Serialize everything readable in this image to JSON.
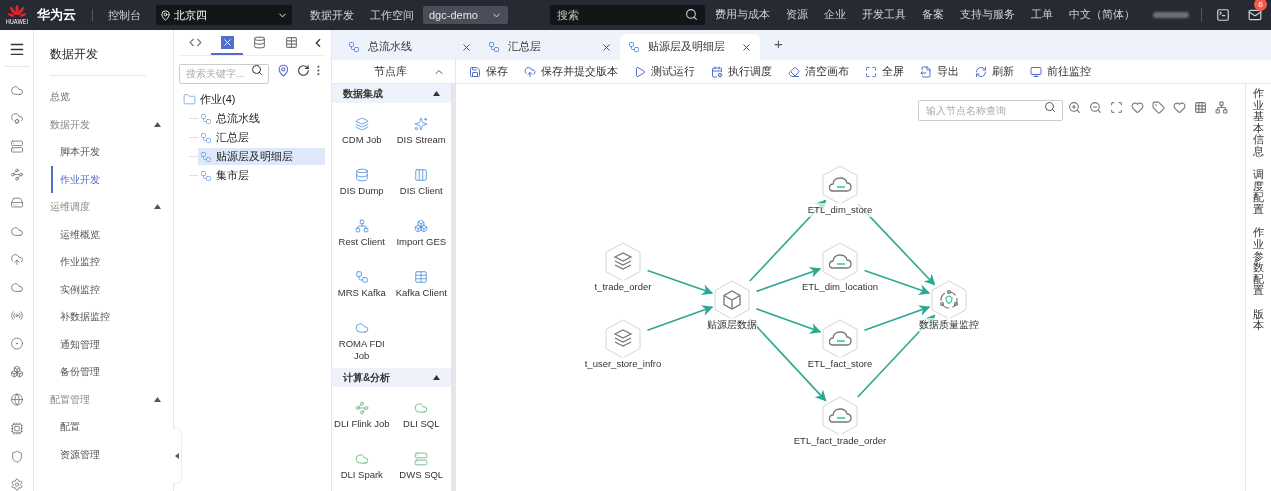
{
  "top_bar": {
    "logo_text": "HUAWEI",
    "brand": "华为云",
    "console": "控制台",
    "region": {
      "value": "北京四"
    },
    "nav_link": "数据开发",
    "workspace": {
      "label": "工作空间",
      "value": "dgc-demo"
    },
    "search": {
      "placeholder": "搜索"
    },
    "menu": [
      "费用与成本",
      "资源",
      "企业",
      "开发工具",
      "备案",
      "支持与服务",
      "工单",
      "中文（简体）"
    ],
    "notifications": {
      "count": "6"
    }
  },
  "side_nav": {
    "title": "数据开发",
    "items": [
      {
        "kind": "link",
        "label": "总览",
        "selected": false
      },
      {
        "kind": "group",
        "label": "数据开发",
        "expanded": true,
        "children": [
          {
            "label": "脚本开发",
            "selected": false
          },
          {
            "label": "作业开发",
            "selected": true
          }
        ]
      },
      {
        "kind": "group",
        "label": "运维调度",
        "expanded": true,
        "children": [
          {
            "label": "运维概览",
            "selected": false
          },
          {
            "label": "作业监控",
            "selected": false
          },
          {
            "label": "实例监控",
            "selected": false
          },
          {
            "label": "补数据监控",
            "selected": false
          },
          {
            "label": "通知管理",
            "selected": false
          },
          {
            "label": "备份管理",
            "selected": false
          }
        ]
      },
      {
        "kind": "group",
        "label": "配置管理",
        "expanded": true,
        "children": [
          {
            "label": "配置",
            "selected": false
          },
          {
            "label": "资源管理",
            "selected": false
          }
        ]
      }
    ]
  },
  "tree_panel": {
    "tabs": [
      {
        "selected": false
      },
      {
        "selected": true
      },
      {
        "selected": false
      },
      {
        "selected": false
      }
    ],
    "search": {
      "placeholder": "搜索关键字..."
    },
    "tree": [
      {
        "label": "作业(4)",
        "expanded": true,
        "children": [
          {
            "label": "总流水线",
            "selected": false
          },
          {
            "label": "汇总层",
            "selected": false
          },
          {
            "label": "贴源层及明细层",
            "selected": true
          },
          {
            "label": "集市层",
            "selected": false
          }
        ]
      }
    ]
  },
  "editor_tabs": [
    {
      "label": "总流水线",
      "selected": false
    },
    {
      "label": "汇总层",
      "selected": false
    },
    {
      "label": "贴源层及明细层",
      "selected": true
    }
  ],
  "add_tab": "+",
  "node_library": {
    "title": "节点库",
    "sections": [
      {
        "title": "数据集成",
        "expanded": true,
        "items": [
          "CDM Job",
          "DIS Stream",
          "DIS Dump",
          "DIS Client",
          "Rest Client",
          "Import GES",
          "MRS Kafka",
          "Kafka Client",
          "ROMA FDI Job"
        ]
      },
      {
        "title": "计算&分析",
        "expanded": true,
        "items": [
          "DLI Flink Job",
          "DLI SQL",
          "DLI Spark",
          "DWS SQL"
        ]
      }
    ]
  },
  "toolbar": [
    "保存",
    "保存并提交版本",
    "测试运行",
    "执行调度",
    "清空画布",
    "全屏",
    "导出",
    "刷新",
    "前往监控"
  ],
  "canvas": {
    "search": {
      "placeholder": "输入节点名称查询"
    },
    "nodes": [
      {
        "label": "t_trade_order",
        "kind": "table"
      },
      {
        "label": "t_user_store_infro",
        "kind": "table"
      },
      {
        "label": "贴源层数据",
        "kind": "cube"
      },
      {
        "label": "ETL_dim_store",
        "kind": "dli"
      },
      {
        "label": "ETL_dim_location",
        "kind": "dli"
      },
      {
        "label": "ETL_fact_store",
        "kind": "dli"
      },
      {
        "label": "ETL_fact_trade_order",
        "kind": "dli"
      },
      {
        "label": "数据质量监控",
        "kind": "quality"
      }
    ]
  },
  "right_panel": [
    "作业基本信息",
    "调度配置",
    "作业参数配置",
    "版本"
  ]
}
